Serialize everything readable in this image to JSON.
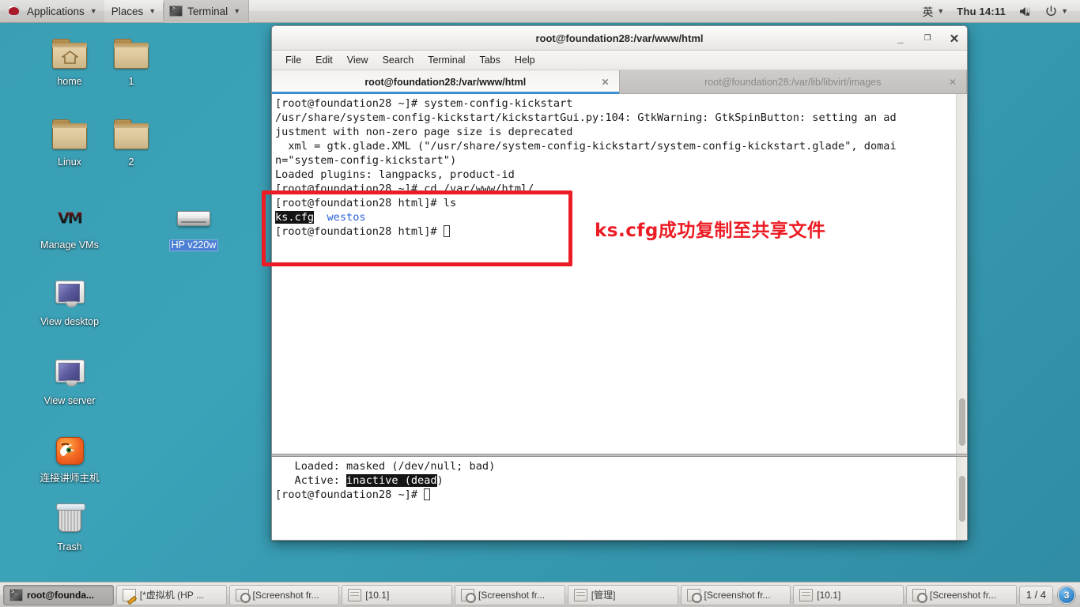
{
  "top_panel": {
    "logo_icon": "redhat-logo-icon",
    "applications": "Applications",
    "places": "Places",
    "active_task": "Terminal",
    "input_method": "英",
    "clock": "Thu 14:11",
    "volume_icon": "speaker-muted-icon",
    "power_icon": "power-icon",
    "caret": "▼"
  },
  "desktop_icons": [
    {
      "label": "home",
      "icon": "home-folder-icon",
      "selected": false
    },
    {
      "label": "1",
      "icon": "folder-icon",
      "selected": false
    },
    {
      "label": "Linux",
      "icon": "folder-icon",
      "selected": false
    },
    {
      "label": "2",
      "icon": "folder-icon",
      "selected": false
    },
    {
      "label": "Manage VMs",
      "icon": "vm-manager-icon",
      "selected": false
    },
    {
      "label": "HP v220w",
      "icon": "usb-drive-icon",
      "selected": true
    },
    {
      "label": "View desktop",
      "icon": "monitor-icon",
      "selected": false
    },
    {
      "label": "View server",
      "icon": "monitor-icon",
      "selected": false
    },
    {
      "label": "连接讲师主机",
      "icon": "firefox-icon",
      "selected": false
    },
    {
      "label": "Trash",
      "icon": "trash-icon",
      "selected": false
    }
  ],
  "terminal": {
    "title": "root@foundation28:/var/www/html",
    "window_buttons": {
      "minimize": "_",
      "maximize": "❐",
      "close": "✕"
    },
    "menu": [
      "File",
      "Edit",
      "View",
      "Search",
      "Terminal",
      "Tabs",
      "Help"
    ],
    "tabs": [
      {
        "label": "root@foundation28:/var/www/html",
        "active": true,
        "close": "✕"
      },
      {
        "label": "root@foundation28:/var/lib/libvirt/images",
        "active": false,
        "close": "✕"
      }
    ],
    "pane_top_lines": [
      "[root@foundation28 ~]# system-config-kickstart",
      "/usr/share/system-config-kickstart/kickstartGui.py:104: GtkWarning: GtkSpinButton: setting an ad",
      "justment with non-zero page size is deprecated",
      "  xml = gtk.glade.XML (\"/usr/share/system-config-kickstart/system-config-kickstart.glade\", domai",
      "n=\"system-config-kickstart\")",
      "Loaded plugins: langpacks, product-id",
      "[root@foundation28 ~]# cd /var/www/html/",
      "[root@foundation28 html]# ls"
    ],
    "ls_output": {
      "highlighted_file": "ks.cfg",
      "gap": "  ",
      "directory": "westos"
    },
    "pane_top_prompt": "[root@foundation28 html]# ",
    "pane_bottom_lines": [
      "   Loaded: masked (/dev/null; bad)",
      "   Active: "
    ],
    "pane_bottom_highlight": "inactive (dead",
    "pane_bottom_tail": ")",
    "pane_bottom_prompt": "[root@foundation28 ~]# "
  },
  "annotation": {
    "text": "ks.cfg成功复制至共享文件",
    "color": "#ec1c24"
  },
  "taskbar": {
    "items": [
      {
        "label": "root@founda...",
        "icon": "terminal-icon",
        "active": true
      },
      {
        "label": "[*虚拟机 (HP ...",
        "icon": "notepad-icon",
        "active": false
      },
      {
        "label": "[Screenshot fr...",
        "icon": "screenshot-icon",
        "active": false
      },
      {
        "label": "[10.1]",
        "icon": "file-icon",
        "active": false
      },
      {
        "label": "[Screenshot fr...",
        "icon": "screenshot-icon",
        "active": false
      },
      {
        "label": "[管理]",
        "icon": "file-icon",
        "active": false
      },
      {
        "label": "[Screenshot fr...",
        "icon": "screenshot-icon",
        "active": false
      },
      {
        "label": "[10.1]",
        "icon": "file-icon",
        "active": false
      },
      {
        "label": "[Screenshot fr...",
        "icon": "screenshot-icon",
        "active": false
      }
    ],
    "page_count": "1 / 4",
    "workspace": "3"
  }
}
